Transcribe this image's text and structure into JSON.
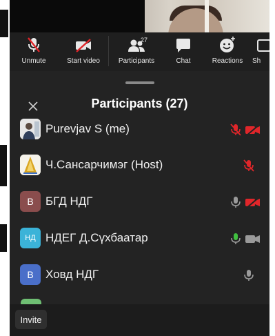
{
  "toolbar": {
    "unmute_label": "Unmute",
    "start_video_label": "Start video",
    "participants_label": "Participants",
    "participants_count": "27",
    "chat_label": "Chat",
    "reactions_label": "Reactions",
    "share_label": "Sh"
  },
  "sheet": {
    "title": "Participants (27)"
  },
  "participants": [
    {
      "name": "Purevjav S (me)",
      "avatar_letter": "",
      "avatar_color": "#d8d8d8",
      "mic": "muted",
      "video": "off"
    },
    {
      "name": "Ч.Сансарчимэг (Host)",
      "avatar_letter": "",
      "avatar_color": "#f3f0e6",
      "mic": "muted",
      "video": "none"
    },
    {
      "name": "БГД НДГ",
      "avatar_letter": "В",
      "avatar_color": "#8a4d4d",
      "mic": "off-gray",
      "video": "off"
    },
    {
      "name": "НДЕГ Д.Сүхбаатар",
      "avatar_letter": "НД",
      "avatar_color": "#3bb3d8",
      "mic": "on",
      "video": "on"
    },
    {
      "name": "Ховд НДГ",
      "avatar_letter": "В",
      "avatar_color": "#4a6fc9",
      "mic": "off-gray",
      "video": "none"
    }
  ],
  "footer": {
    "invite_label": "Invite"
  },
  "colors": {
    "muted_red": "#e0262a",
    "mic_green": "#3fbf3f",
    "icon_gray": "#9a9a9a",
    "sheet_bg": "#232323"
  }
}
